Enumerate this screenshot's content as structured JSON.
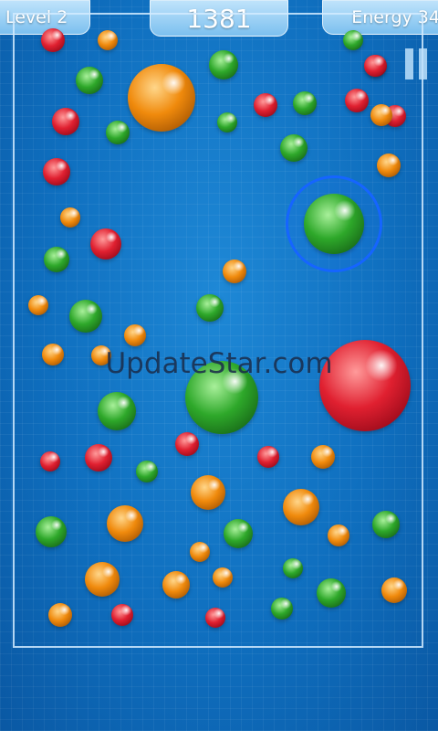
{
  "hud": {
    "level": "Level 2",
    "score": "1381",
    "energy": "Energy 34"
  },
  "watermark": "UpdateStar.com",
  "pause_icon": "pause-icon",
  "colors": {
    "red": "#d8182a",
    "orange": "#f08a0c",
    "green": "#2ea82a",
    "selection_ring": "#1565ff"
  },
  "bubbles": [
    {
      "color": "red",
      "selected": false
    },
    {
      "color": "orange",
      "selected": false
    },
    {
      "color": "green",
      "selected": false
    },
    {
      "color": "red",
      "selected": false
    },
    {
      "color": "green",
      "selected": false
    },
    {
      "color": "orange",
      "selected": false
    },
    {
      "color": "green",
      "selected": false
    },
    {
      "color": "red",
      "selected": false
    },
    {
      "color": "red",
      "selected": false
    },
    {
      "color": "green",
      "selected": false
    },
    {
      "color": "green",
      "selected": false
    },
    {
      "color": "red",
      "selected": false
    },
    {
      "color": "red",
      "selected": false
    },
    {
      "color": "green",
      "selected": false
    },
    {
      "color": "green",
      "selected": false
    },
    {
      "color": "red",
      "selected": false
    },
    {
      "color": "orange",
      "selected": false
    },
    {
      "color": "green",
      "selected": true
    },
    {
      "color": "orange",
      "selected": false
    },
    {
      "color": "red",
      "selected": false
    },
    {
      "color": "green",
      "selected": false
    },
    {
      "color": "orange",
      "selected": false
    },
    {
      "color": "green",
      "selected": false
    },
    {
      "color": "orange",
      "selected": false
    },
    {
      "color": "green",
      "selected": false
    },
    {
      "color": "orange",
      "selected": false
    },
    {
      "color": "orange",
      "selected": false
    },
    {
      "color": "orange",
      "selected": false
    },
    {
      "color": "green",
      "selected": false
    },
    {
      "color": "green",
      "selected": false
    },
    {
      "color": "red",
      "selected": false
    },
    {
      "color": "red",
      "selected": false
    },
    {
      "color": "red",
      "selected": false
    },
    {
      "color": "red",
      "selected": false
    },
    {
      "color": "red",
      "selected": false
    },
    {
      "color": "green",
      "selected": false
    },
    {
      "color": "orange",
      "selected": false
    },
    {
      "color": "orange",
      "selected": false
    },
    {
      "color": "orange",
      "selected": false
    },
    {
      "color": "green",
      "selected": false
    },
    {
      "color": "orange",
      "selected": false
    },
    {
      "color": "green",
      "selected": false
    },
    {
      "color": "orange",
      "selected": false
    },
    {
      "color": "green",
      "selected": false
    },
    {
      "color": "orange",
      "selected": false
    },
    {
      "color": "orange",
      "selected": false
    },
    {
      "color": "orange",
      "selected": false
    },
    {
      "color": "orange",
      "selected": false
    },
    {
      "color": "green",
      "selected": false
    },
    {
      "color": "green",
      "selected": false
    },
    {
      "color": "orange",
      "selected": false
    },
    {
      "color": "orange",
      "selected": false
    },
    {
      "color": "red",
      "selected": false
    },
    {
      "color": "red",
      "selected": false
    },
    {
      "color": "green",
      "selected": false
    },
    {
      "color": "orange",
      "selected": false
    },
    {
      "color": "red",
      "selected": false
    }
  ]
}
